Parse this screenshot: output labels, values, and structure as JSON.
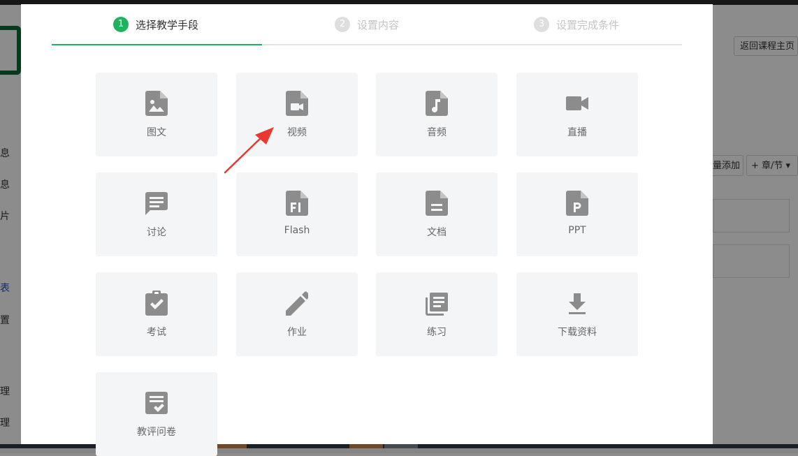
{
  "background": {
    "return_button": "返回课程主页",
    "sidebar_fragments": [
      "息",
      "息",
      "片",
      "表",
      "置",
      "理",
      "理"
    ],
    "toolbar": {
      "batch_add": "量添加",
      "chapter_button": "+ 章/节 ▾"
    }
  },
  "modal": {
    "steps": [
      {
        "num": "1",
        "label": "选择教学手段",
        "state": "active"
      },
      {
        "num": "2",
        "label": "设置内容",
        "state": "inactive"
      },
      {
        "num": "3",
        "label": "设置完成条件",
        "state": "inactive"
      }
    ],
    "tiles": [
      {
        "label": "图文",
        "icon": "image-file-icon"
      },
      {
        "label": "视频",
        "icon": "video-file-icon"
      },
      {
        "label": "音频",
        "icon": "audio-file-icon"
      },
      {
        "label": "直播",
        "icon": "video-camera-icon"
      },
      {
        "label": "讨论",
        "icon": "comment-icon"
      },
      {
        "label": "Flash",
        "icon": "flash-file-icon"
      },
      {
        "label": "文档",
        "icon": "document-file-icon"
      },
      {
        "label": "PPT",
        "icon": "ppt-file-icon"
      },
      {
        "label": "考试",
        "icon": "clipboard-check-icon"
      },
      {
        "label": "作业",
        "icon": "pencil-icon"
      },
      {
        "label": "练习",
        "icon": "library-books-icon"
      },
      {
        "label": "下载资料",
        "icon": "download-icon"
      },
      {
        "label": "教评问卷",
        "icon": "survey-check-icon"
      }
    ]
  },
  "colors": {
    "accent": "#1fb35e",
    "icon": "#8c8c8c",
    "tile_bg": "#f4f5f6",
    "annotation_arrow": "#e8382f"
  }
}
